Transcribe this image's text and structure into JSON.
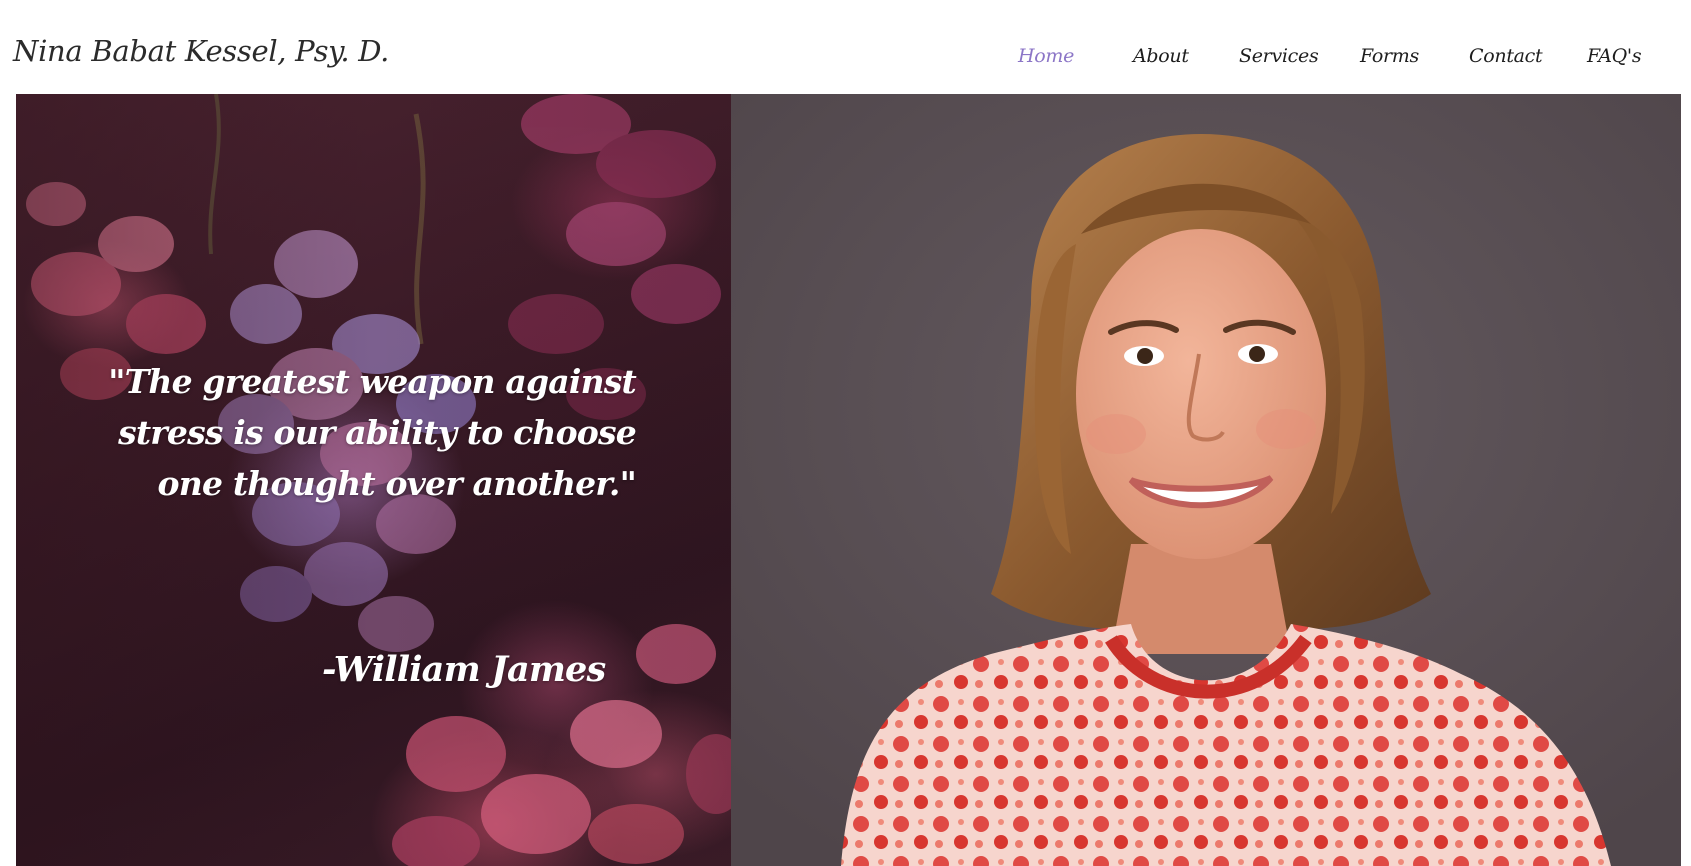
{
  "site": {
    "title": "Nina Babat Kessel, Psy. D."
  },
  "nav": {
    "items": [
      {
        "label": "Home",
        "active": true
      },
      {
        "label": "About"
      },
      {
        "label": "Services"
      },
      {
        "label": "Forms"
      },
      {
        "label": "Contact"
      },
      {
        "label": "FAQ's"
      }
    ]
  },
  "hero": {
    "quote_lines": [
      "\"The greatest weapon against",
      "stress is our ability to choose",
      "one thought over another.\""
    ],
    "author": "-William James",
    "colors": {
      "accent_nav": "#8c76c7",
      "photo_background": "#5a4f54",
      "quote_text": "#ffffff"
    }
  }
}
